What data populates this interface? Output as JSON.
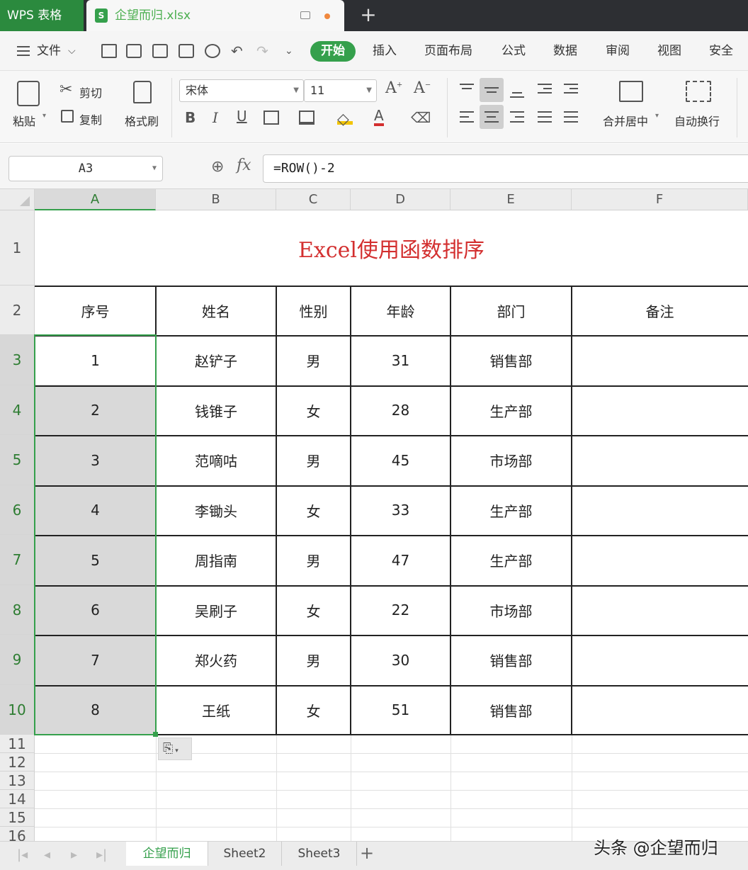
{
  "titlebar": {
    "app_name": "WPS 表格",
    "doc_name": "企望而归.xlsx",
    "new_tab": "+"
  },
  "menu": {
    "file": "文件",
    "tabs": [
      "开始",
      "插入",
      "页面布局",
      "公式",
      "数据",
      "审阅",
      "视图",
      "安全"
    ]
  },
  "ribbon": {
    "paste": "粘贴",
    "cut": "剪切",
    "copy": "复制",
    "format_painter": "格式刷",
    "font_name": "宋体",
    "font_size": "11",
    "merge_center": "合并居中",
    "wrap_text": "自动换行"
  },
  "formula_bar": {
    "name_box": "A3",
    "fx": "fx",
    "formula": "=ROW()-2"
  },
  "sheet": {
    "columns": [
      "A",
      "B",
      "C",
      "D",
      "E",
      "F"
    ],
    "row_numbers": [
      "1",
      "2",
      "3",
      "4",
      "5",
      "6",
      "7",
      "8",
      "9",
      "10",
      "11",
      "12",
      "13",
      "14",
      "15",
      "16"
    ],
    "title": "Excel使用函数排序",
    "headers": [
      "序号",
      "姓名",
      "性别",
      "年龄",
      "部门",
      "备注"
    ],
    "rows": [
      [
        "1",
        "赵铲子",
        "男",
        "31",
        "销售部",
        ""
      ],
      [
        "2",
        "钱锥子",
        "女",
        "28",
        "生产部",
        ""
      ],
      [
        "3",
        "范嘀咕",
        "男",
        "45",
        "市场部",
        ""
      ],
      [
        "4",
        "李锄头",
        "女",
        "33",
        "生产部",
        ""
      ],
      [
        "5",
        "周指南",
        "男",
        "47",
        "生产部",
        ""
      ],
      [
        "6",
        "吴刷子",
        "女",
        "22",
        "市场部",
        ""
      ],
      [
        "7",
        "郑火药",
        "男",
        "30",
        "销售部",
        ""
      ],
      [
        "8",
        "王纸",
        "女",
        "51",
        "销售部",
        ""
      ]
    ],
    "selected_range": "A3:A10",
    "accent_color": "#35a04c",
    "title_color": "#d32f2f"
  },
  "sheet_tabs": [
    "企望而归",
    "Sheet2",
    "Sheet3"
  ],
  "active_sheet": "企望而归",
  "add_sheet": "+",
  "watermark": "头条 @企望而归"
}
